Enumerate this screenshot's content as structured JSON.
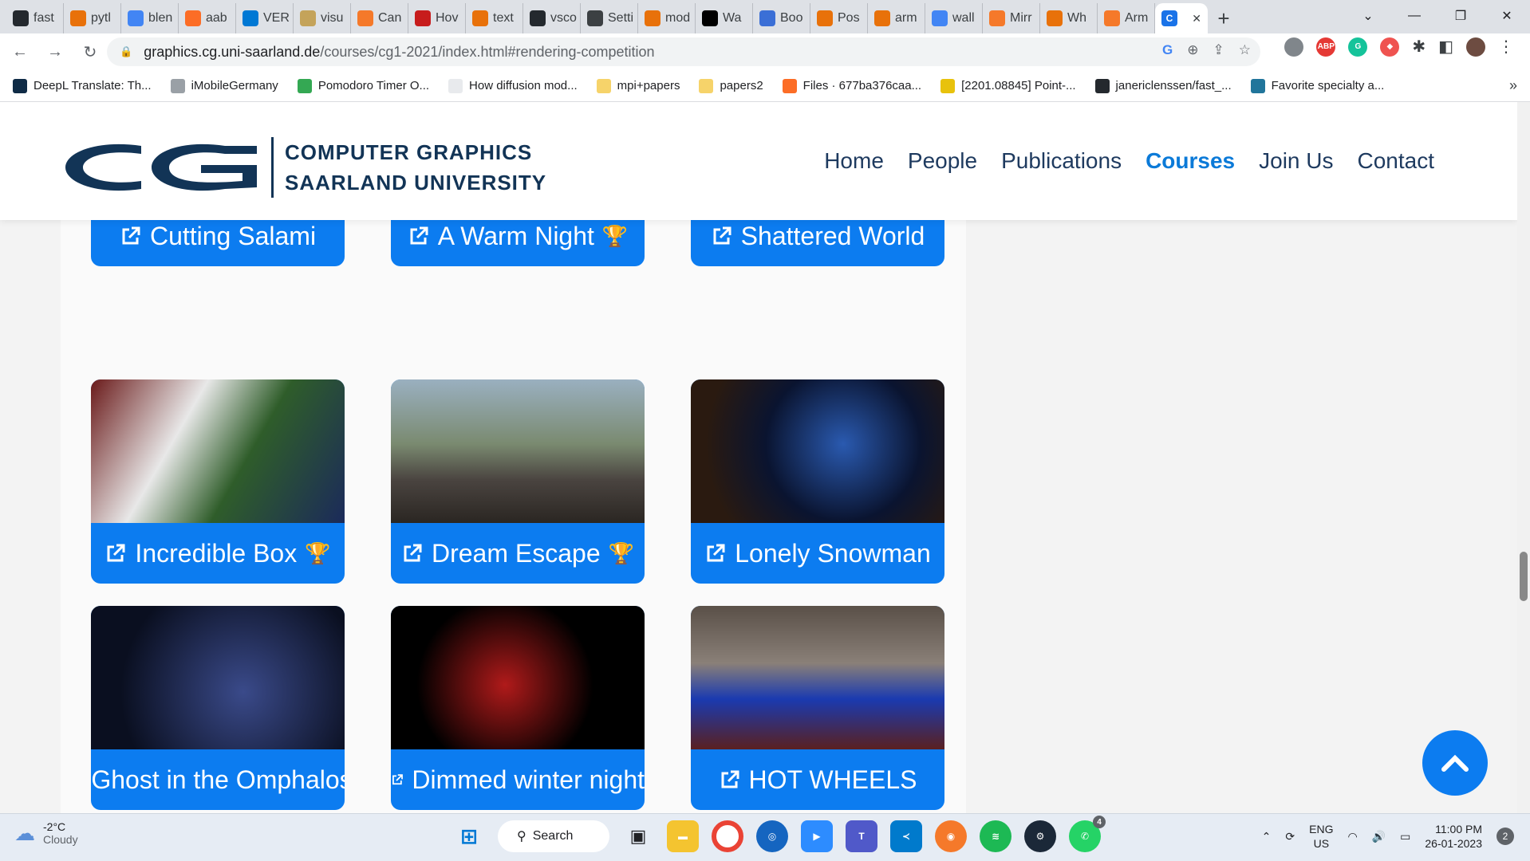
{
  "browser": {
    "tabs": [
      {
        "label": "fast",
        "icon": "github-icon",
        "color": "#24292e"
      },
      {
        "label": "pytl",
        "icon": "location-icon",
        "color": "#e8710a"
      },
      {
        "label": "blen",
        "icon": "google-icon",
        "color": "#4285f4"
      },
      {
        "label": "aab",
        "icon": "gitlab-icon",
        "color": "#fc6d26"
      },
      {
        "label": "VER",
        "icon": "windows-icon",
        "color": "#0078d4"
      },
      {
        "label": "visu",
        "icon": "pen-icon",
        "color": "#c4a35a"
      },
      {
        "label": "Can",
        "icon": "blender-icon",
        "color": "#f5792a"
      },
      {
        "label": "Hov",
        "icon": "bookmark-icon",
        "color": "#c71c1c"
      },
      {
        "label": "text",
        "icon": "location-icon",
        "color": "#e8710a"
      },
      {
        "label": "vsco",
        "icon": "github-icon",
        "color": "#24292e"
      },
      {
        "label": "Setti",
        "icon": "gear-icon",
        "color": "#3c4043"
      },
      {
        "label": "mod",
        "icon": "location-icon",
        "color": "#e8710a"
      },
      {
        "label": "Wa",
        "icon": "wikipedia-icon",
        "color": "#000000"
      },
      {
        "label": "Boo",
        "icon": "3d-icon",
        "color": "#3b6fd6"
      },
      {
        "label": "Pos",
        "icon": "location-icon",
        "color": "#e8710a"
      },
      {
        "label": "arm",
        "icon": "location-icon",
        "color": "#e8710a"
      },
      {
        "label": "wall",
        "icon": "google-icon",
        "color": "#4285f4"
      },
      {
        "label": "Mirr",
        "icon": "blender-icon",
        "color": "#f5792a"
      },
      {
        "label": "Wh",
        "icon": "location-icon",
        "color": "#e8710a"
      },
      {
        "label": "Arm",
        "icon": "blender-icon",
        "color": "#f5792a"
      }
    ],
    "active_tab": {
      "icon": "cg-icon",
      "close": "✕"
    },
    "new_tab": "+",
    "url": {
      "host": "graphics.cg.uni-saarland.de",
      "path": "/courses/cg1-2021/index.html#rendering-competition"
    },
    "bookmarks": [
      {
        "label": "DeepL Translate: Th...",
        "color": "#0f2b46"
      },
      {
        "label": "iMobileGermany",
        "color": "#9aa0a6"
      },
      {
        "label": "Pomodoro Timer O...",
        "color": "#34a853"
      },
      {
        "label": "How diffusion mod...",
        "color": "#e8eaed"
      },
      {
        "label": "mpi+papers",
        "color": "#f6d36a"
      },
      {
        "label": "papers2",
        "color": "#f6d36a"
      },
      {
        "label": "Files · 677ba376caa...",
        "color": "#fc6d26"
      },
      {
        "label": "[2201.08845] Point-...",
        "color": "#e8c20c"
      },
      {
        "label": "janericlenssen/fast_...",
        "color": "#24292e"
      },
      {
        "label": "Favorite specialty a...",
        "color": "#21759b"
      }
    ],
    "bookmarks_more": "»"
  },
  "site": {
    "logo_line1": "COMPUTER GRAPHICS",
    "logo_line2": "SAARLAND UNIVERSITY",
    "nav": [
      "Home",
      "People",
      "Publications",
      "Courses",
      "Join Us",
      "Contact"
    ],
    "active_nav": "Courses"
  },
  "entries": [
    {
      "title": "Cutting Salami",
      "trophy": false
    },
    {
      "title": "A Warm Night",
      "trophy": true
    },
    {
      "title": "Shattered World",
      "trophy": false
    },
    {
      "title": "Incredible Box",
      "trophy": true
    },
    {
      "title": "Dream Escape",
      "trophy": true
    },
    {
      "title": "Lonely Snowman",
      "trophy": false
    },
    {
      "title": "Ghost in the Omphalos",
      "trophy": false
    },
    {
      "title": "Dimmed winter night",
      "trophy": false
    },
    {
      "title": "HOT WHEELS",
      "trophy": false
    }
  ],
  "taskbar": {
    "weather_temp": "-2°C",
    "weather_desc": "Cloudy",
    "search": "Search",
    "lang1": "ENG",
    "lang2": "US",
    "time": "11:00 PM",
    "date": "26-01-2023",
    "notification_count": "2",
    "whatsapp_badge": "4"
  }
}
